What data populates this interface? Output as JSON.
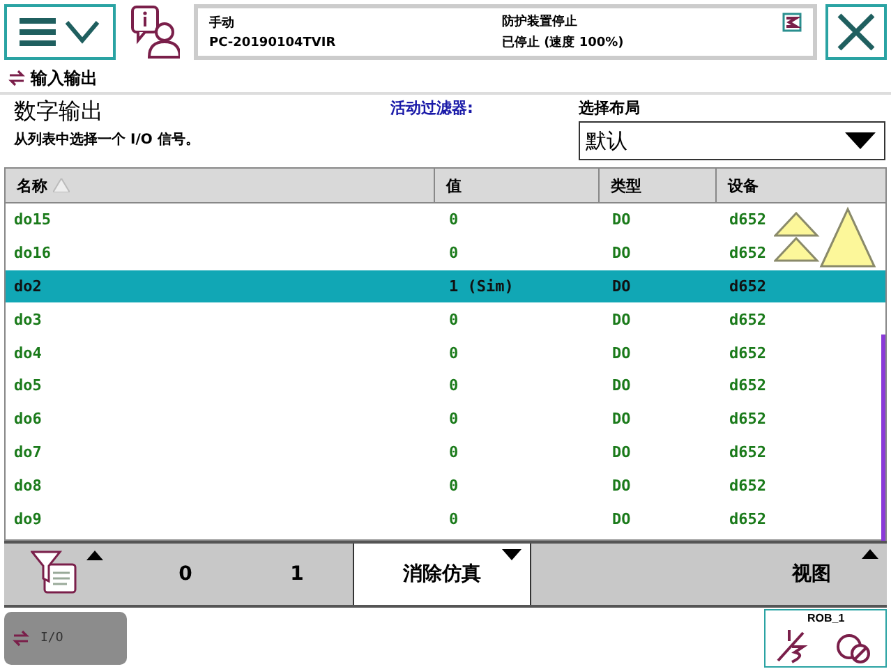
{
  "status": {
    "mode": "手动",
    "controller": "PC-20190104TVIR",
    "safety": "防护装置停止",
    "state": "已停止 (速度 100%)"
  },
  "app_title": "输入输出",
  "header": {
    "title": "数字输出",
    "hint": "从列表中选择一个 I/O 信号。",
    "filter_label": "活动过滤器:",
    "layout_label": "选择布局",
    "layout_value": "默认"
  },
  "table": {
    "columns": [
      "名称",
      "值",
      "类型",
      "设备"
    ],
    "rows": [
      {
        "cells": [
          "do15",
          "0",
          "DO",
          "d652"
        ],
        "selected": false
      },
      {
        "cells": [
          "do16",
          "0",
          "DO",
          "d652"
        ],
        "selected": false
      },
      {
        "cells": [
          "do2",
          "1 (Sim)",
          "DO",
          "d652"
        ],
        "selected": true
      },
      {
        "cells": [
          "do3",
          "0",
          "DO",
          "d652"
        ],
        "selected": false
      },
      {
        "cells": [
          "do4",
          "0",
          "DO",
          "d652"
        ],
        "selected": false
      },
      {
        "cells": [
          "do5",
          "0",
          "DO",
          "d652"
        ],
        "selected": false
      },
      {
        "cells": [
          "do6",
          "0",
          "DO",
          "d652"
        ],
        "selected": false
      },
      {
        "cells": [
          "do7",
          "0",
          "DO",
          "d652"
        ],
        "selected": false
      },
      {
        "cells": [
          "do8",
          "0",
          "DO",
          "d652"
        ],
        "selected": false
      },
      {
        "cells": [
          "do9",
          "0",
          "DO",
          "d652"
        ],
        "selected": false
      }
    ]
  },
  "toolbar": {
    "value_0": "0",
    "value_1": "1",
    "clear_sim": "消除仿真",
    "view": "视图"
  },
  "taskbar": {
    "app": "I/O",
    "robot": "ROB_1"
  }
}
